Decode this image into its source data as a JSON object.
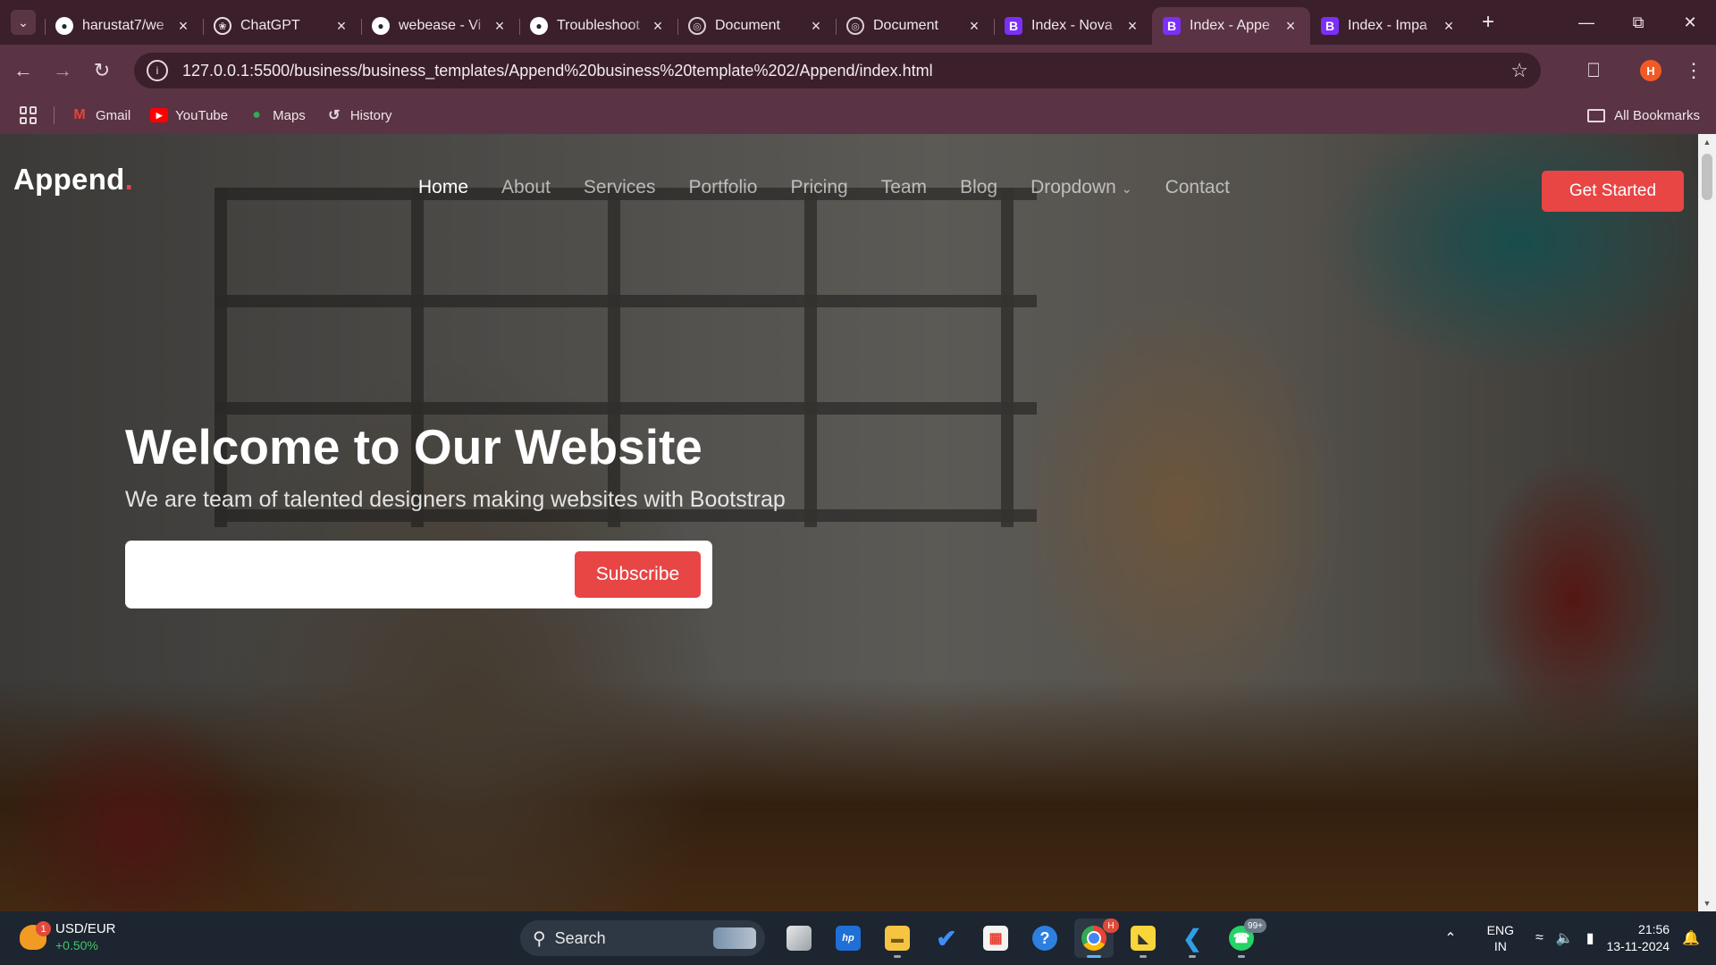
{
  "browser": {
    "tabs": [
      {
        "title": "harustat7/we",
        "icon": "github-icon",
        "active": false
      },
      {
        "title": "ChatGPT",
        "icon": "chatgpt-icon",
        "active": false
      },
      {
        "title": "webease - Vi",
        "icon": "github-icon",
        "active": false
      },
      {
        "title": "Troubleshoot",
        "icon": "github-icon",
        "active": false
      },
      {
        "title": "Document",
        "icon": "globe-icon",
        "active": false
      },
      {
        "title": "Document",
        "icon": "globe-icon",
        "active": false
      },
      {
        "title": "Index - Nova",
        "icon": "bootstrap-icon",
        "active": false
      },
      {
        "title": "Index - Appe",
        "icon": "bootstrap-icon",
        "active": true
      },
      {
        "title": "Index - Impa",
        "icon": "bootstrap-icon",
        "active": false
      }
    ],
    "url": "127.0.0.1:5500/business/business_templates/Append%20business%20template%202/Append/index.html",
    "profile_initial": "H",
    "bookmarks": [
      {
        "label": "Gmail",
        "icon": "gmail-icon"
      },
      {
        "label": "YouTube",
        "icon": "youtube-icon"
      },
      {
        "label": "Maps",
        "icon": "maps-icon"
      },
      {
        "label": "History",
        "icon": "history-icon"
      }
    ],
    "all_bookmarks_label": "All Bookmarks"
  },
  "site": {
    "logo": "Append",
    "logo_dot": ".",
    "nav": [
      "Home",
      "About",
      "Services",
      "Portfolio",
      "Pricing",
      "Team",
      "Blog",
      "Dropdown",
      "Contact"
    ],
    "active_nav": "Home",
    "cta": "Get Started",
    "hero": {
      "title": "Welcome to Our Website",
      "subtitle": "We are team of talented designers making websites with Bootstrap",
      "input_value": "",
      "button": "Subscribe"
    }
  },
  "taskbar": {
    "widget": {
      "title": "USD/EUR",
      "change": "+0.50%",
      "badge": "1"
    },
    "search_placeholder": "Search",
    "apps": [
      {
        "name": "task-view",
        "badge": ""
      },
      {
        "name": "myhp",
        "badge": ""
      },
      {
        "name": "file-explorer",
        "badge": ""
      },
      {
        "name": "todo",
        "badge": ""
      },
      {
        "name": "microsoft-store",
        "badge": ""
      },
      {
        "name": "get-help",
        "badge": ""
      },
      {
        "name": "chrome",
        "badge": "H"
      },
      {
        "name": "sticky-notes",
        "badge": ""
      },
      {
        "name": "vscode",
        "badge": ""
      },
      {
        "name": "whatsapp",
        "badge": "99+"
      }
    ],
    "language": {
      "line1": "ENG",
      "line2": "IN"
    },
    "time": "21:56",
    "date": "13-11-2024"
  },
  "colors": {
    "accent": "#e84545",
    "tabstrip": "#3b1f2b",
    "toolbar": "#5a3344",
    "taskbar": "#1c2530"
  }
}
